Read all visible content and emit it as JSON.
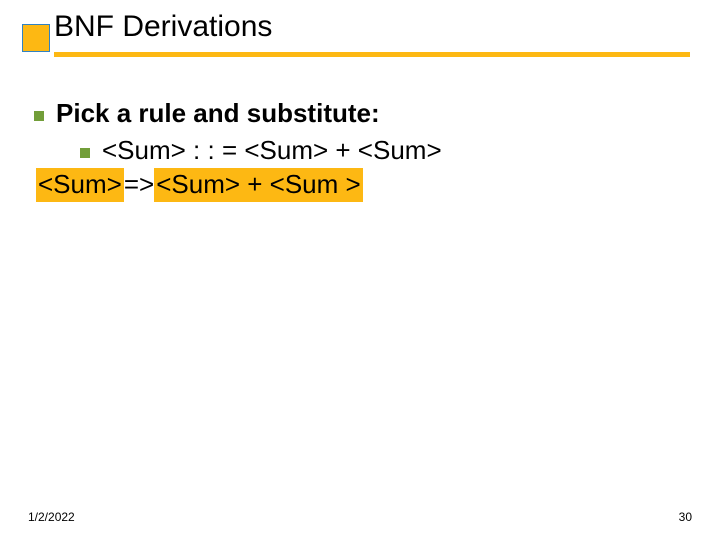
{
  "title": "BNF Derivations",
  "bullets": {
    "main": "Pick a rule and substitute:",
    "sub": "<Sum> : : = <Sum> + <Sum>"
  },
  "derivation": {
    "hl1": "<Sum>",
    "mid": " => ",
    "hl2": "<Sum> + <Sum >"
  },
  "footer": {
    "date": "1/2/2022",
    "page": "30"
  }
}
